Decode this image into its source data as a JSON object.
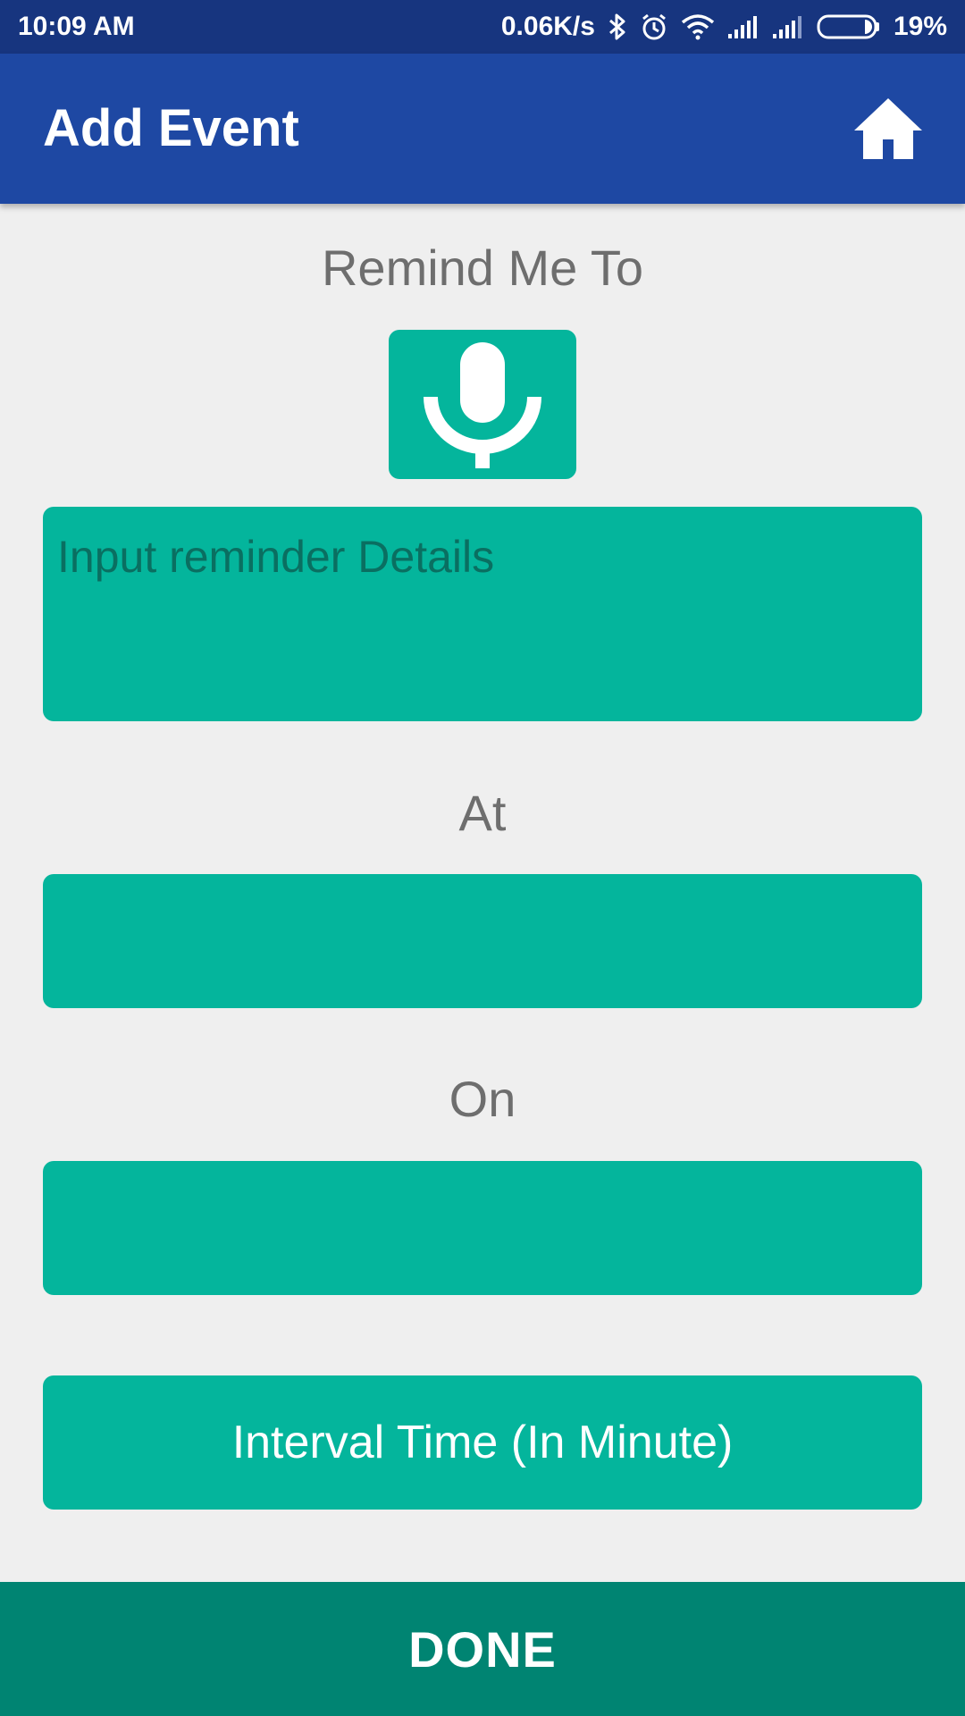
{
  "status_bar": {
    "time": "10:09 AM",
    "network_speed": "0.06K/s",
    "battery": "19%",
    "icons": [
      "bluetooth-icon",
      "alarm-icon",
      "wifi-icon",
      "signal-icon",
      "signal-icon",
      "battery-icon"
    ]
  },
  "app_bar": {
    "title": "Add Event",
    "home_icon": "home-icon"
  },
  "form": {
    "remind_label": "Remind Me To",
    "mic_icon": "microphone-icon",
    "details_placeholder": "Input reminder Details",
    "at_label": "At",
    "at_value": "",
    "on_label": "On",
    "on_value": "",
    "interval_label": "Interval Time (In Minute)"
  },
  "footer": {
    "done_label": "DONE"
  },
  "colors": {
    "status_bar": "#17357f",
    "app_bar": "#1e48a3",
    "accent": "#04b59c",
    "done_bar": "#008472",
    "background": "#efefef",
    "label_text": "#6e6e6e"
  }
}
